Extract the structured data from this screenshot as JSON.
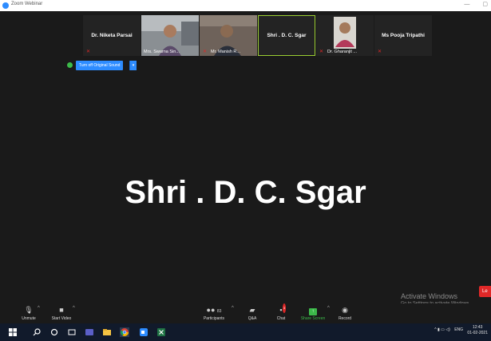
{
  "window": {
    "title": "Zoom Webinar"
  },
  "video_strip": [
    {
      "name": "Dr. Niketa Parsai",
      "has_video": false,
      "muted": true
    },
    {
      "name": "Mrs. Swarna Sin...",
      "has_video": true,
      "muted": false
    },
    {
      "name": "Mr. Manish R...",
      "has_video": true,
      "muted": true
    },
    {
      "name": "Shri . D. C. Sgar",
      "has_video": false,
      "muted": false,
      "active": true
    },
    {
      "name": "Dr. Gharanjit ...",
      "has_video": true,
      "muted": true
    },
    {
      "name": "Ms Pooja Tripathi",
      "has_video": false,
      "muted": true
    }
  ],
  "original_sound_button": {
    "label": "Turn off Original Sound"
  },
  "active_speaker": {
    "name": "Shri . D. C. Sgar"
  },
  "watermark": {
    "line1": "Activate Windows",
    "line2": "Go to Settings to activate Windows."
  },
  "leave_button": {
    "label": "Le"
  },
  "toolbar": {
    "unmute": "Unmute",
    "start_video": "Start Video",
    "participants": "Participants",
    "participants_count": "83",
    "qa": "Q&A",
    "chat": "Chat",
    "chat_badge": "3",
    "share_screen": "Share Screen",
    "record": "Record"
  },
  "taskbar": {
    "language": "ENG",
    "time": "12:43",
    "date": "01-02-2021"
  },
  "colors": {
    "accent": "#2d8cff",
    "share_green": "#3cba4a",
    "muted_red": "#e02828",
    "active_border": "#9acd32"
  }
}
